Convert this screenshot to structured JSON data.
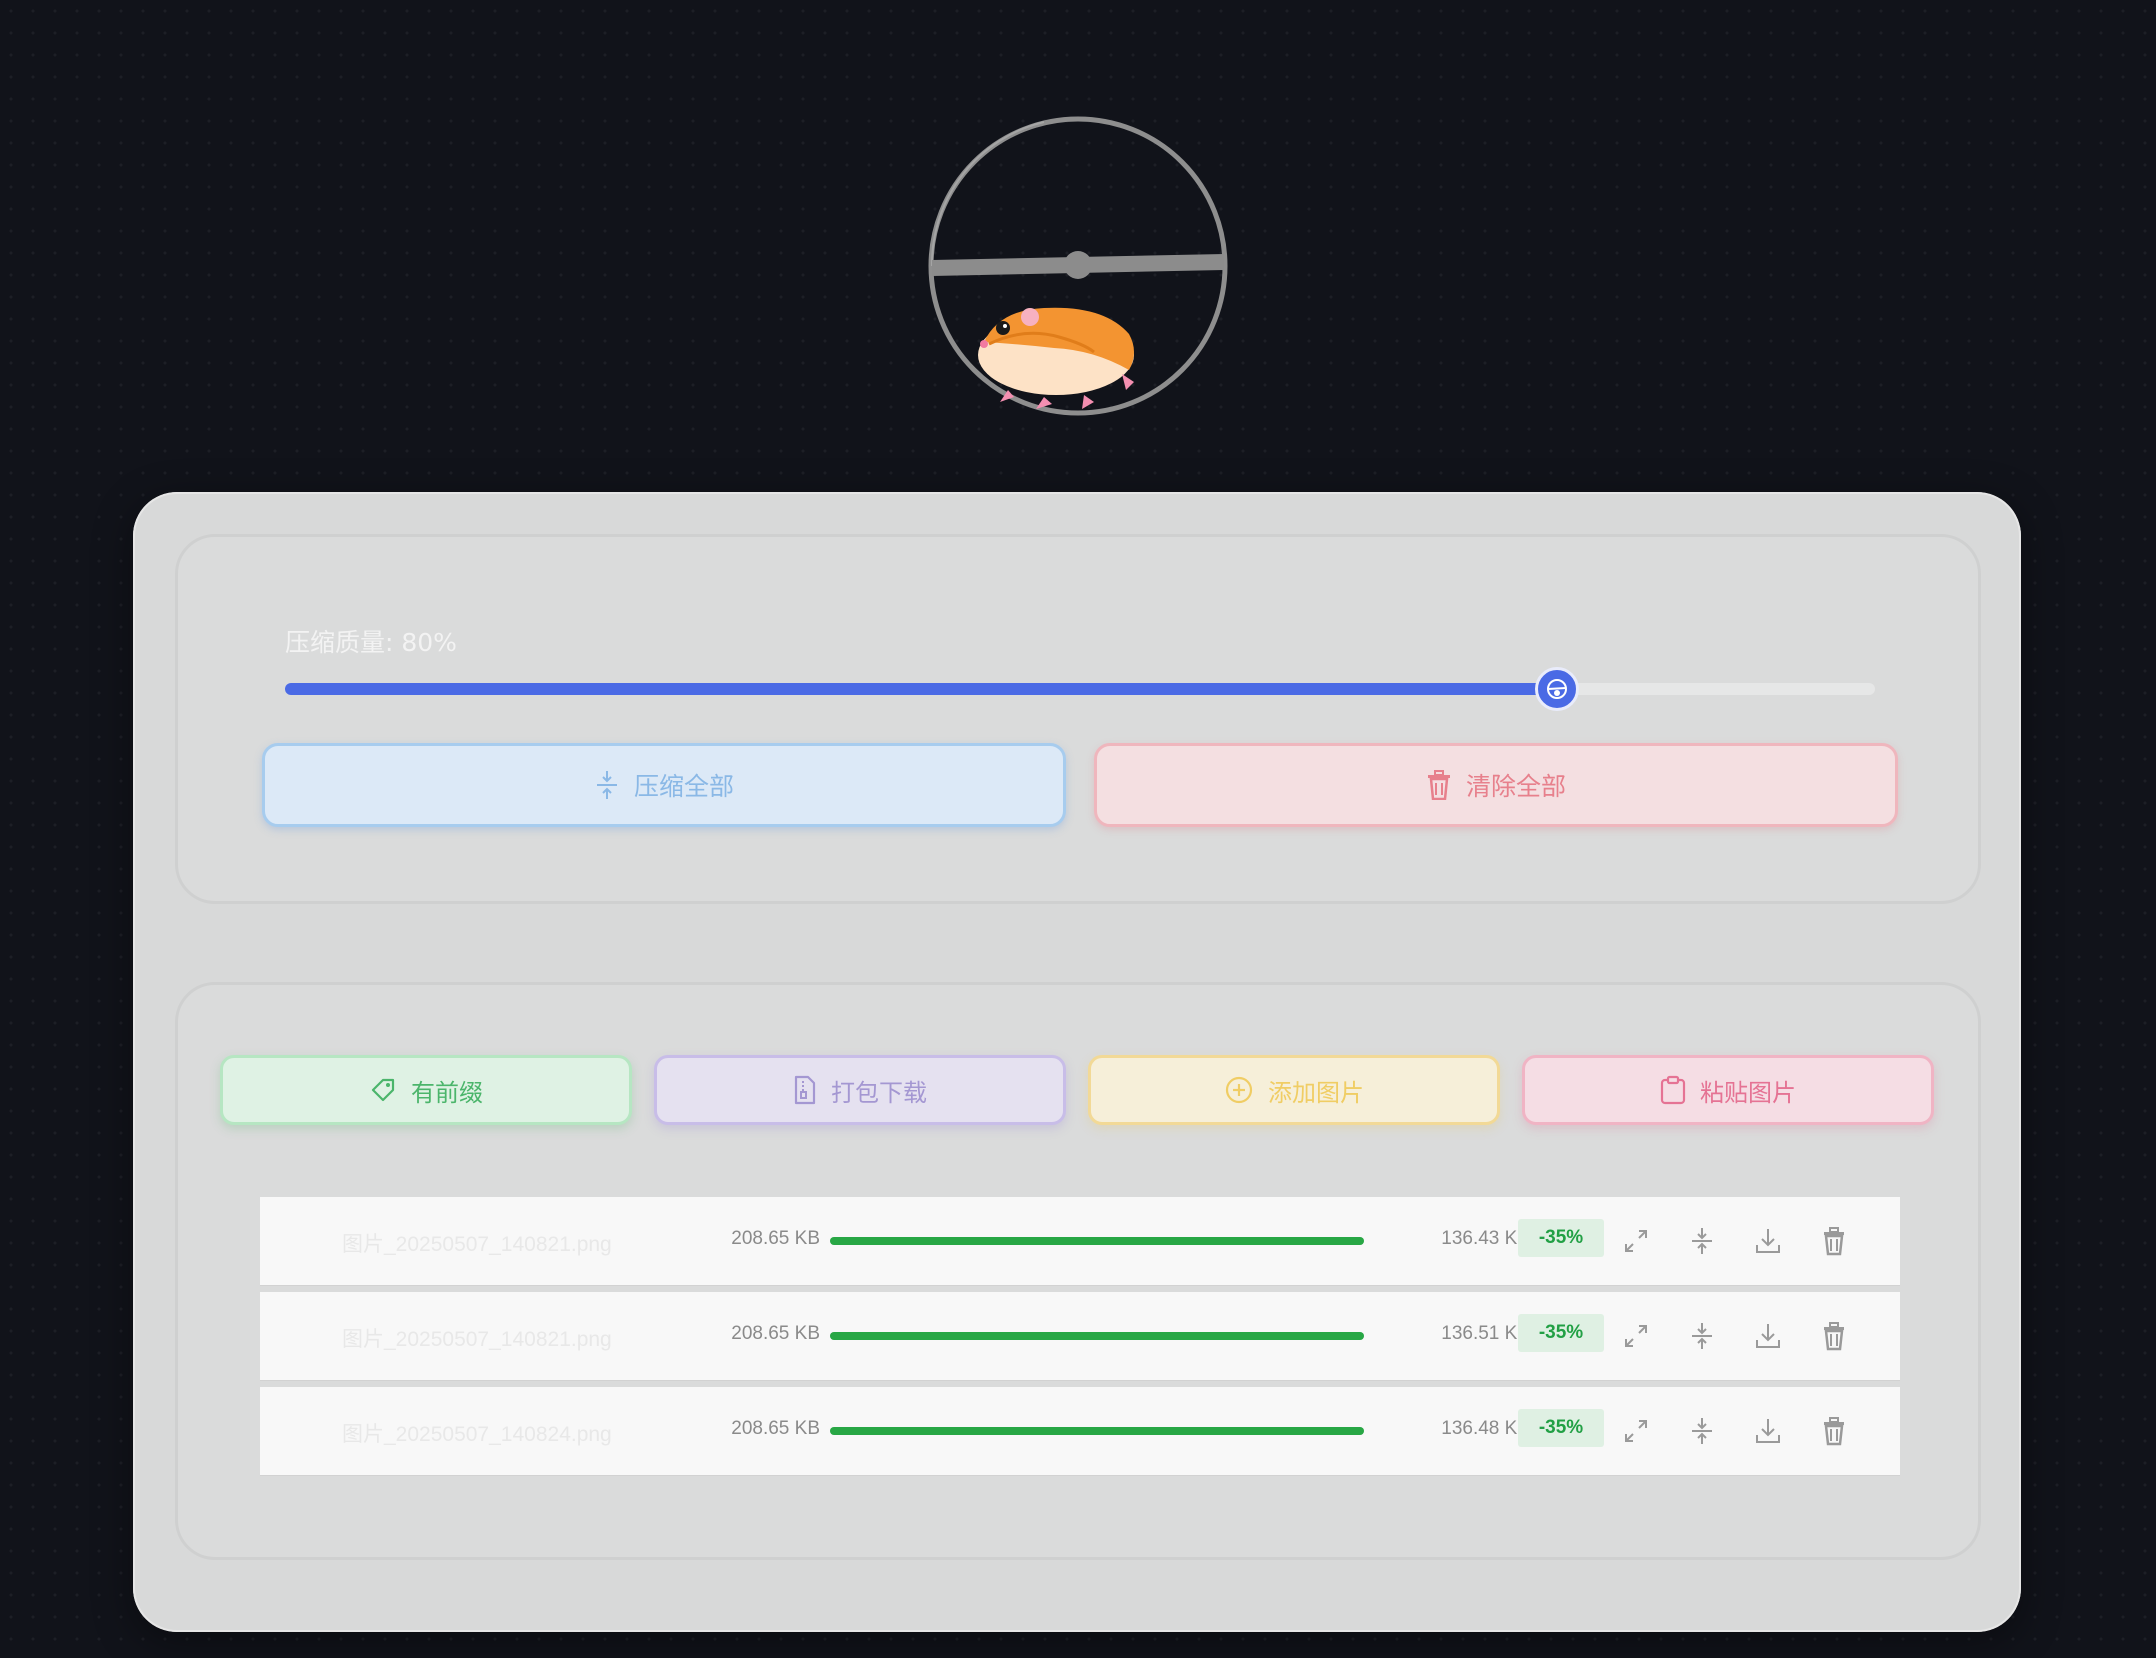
{
  "accent": "#4a6ae5",
  "logo": {
    "name": "hamster-wheel-logo"
  },
  "quality": {
    "label": "压缩质量: 80%",
    "value": 80
  },
  "actions": {
    "compress_all": "压缩全部",
    "clear_all": "清除全部",
    "prefix": "有前缀",
    "zip_download": "打包下载",
    "add_images": "添加图片",
    "paste_images": "粘贴图片"
  },
  "files": [
    {
      "name": "图片_20250507_140821.png",
      "original": "208.65 KB",
      "compressed": "136.43 KB",
      "saving": "-35%",
      "progress": 100
    },
    {
      "name": "图片_20250507_140821.png",
      "original": "208.65 KB",
      "compressed": "136.51 KB",
      "saving": "-35%",
      "progress": 100
    },
    {
      "name": "图片_20250507_140824.png",
      "original": "208.65 KB",
      "compressed": "136.48 KB",
      "saving": "-35%",
      "progress": 100
    }
  ],
  "row_icons": [
    "expand-icon",
    "compress-icon",
    "download-icon",
    "trash-icon"
  ]
}
